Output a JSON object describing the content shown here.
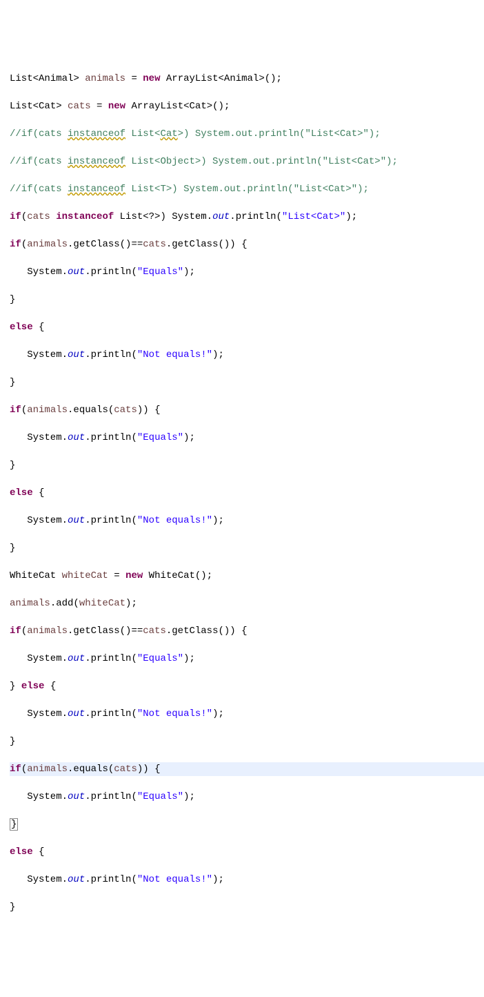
{
  "code": {
    "l1": {
      "p1": "List",
      "p2": "<",
      "p3": "Animal",
      "p4": "> ",
      "p5": "animals",
      "p6": " = ",
      "p7": "new",
      "p8": " ArrayList<",
      "p9": "Animal",
      "p10": ">();"
    },
    "l2": {
      "p1": "List",
      "p2": "<",
      "p3": "Cat",
      "p4": "> ",
      "p5": "cats",
      "p6": " = ",
      "p7": "new",
      "p8": " ArrayList<",
      "p9": "Cat",
      "p10": ">();"
    },
    "l3": {
      "p1": "//if(cats ",
      "p2": "instanceof",
      "p3": " List<",
      "p4": "Cat",
      "p5": ">) System.out.println(\"List<Cat>\");"
    },
    "l4": {
      "p1": "//if(cats ",
      "p2": "instanceof",
      "p3": " List<Object>) System.out.println(\"List<Cat>\");"
    },
    "l5": {
      "p1": "//if(cats ",
      "p2": "instanceof",
      "p3": " List<",
      "p4": "T",
      "p5": ">) System.out.println(\"List<Cat>\");"
    },
    "l6": {
      "p1": "if",
      "p2": "(",
      "p3": "cats",
      "p4": " ",
      "p5": "instanceof",
      "p6": " List<?>) System.",
      "p7": "out",
      "p8": ".println(",
      "p9": "\"List<Cat>\"",
      "p10": ");"
    },
    "l7": {
      "p1": "if",
      "p2": "(",
      "p3": "animals",
      "p4": ".getClass()==",
      "p5": "cats",
      "p6": ".getClass()) {"
    },
    "l8": {
      "p1": "   System.",
      "p2": "out",
      "p3": ".println(",
      "p4": "\"Equals\"",
      "p5": ");"
    },
    "l9": {
      "p1": "}"
    },
    "l10": {
      "p1": "else",
      "p2": " {"
    },
    "l11": {
      "p1": "   System.",
      "p2": "out",
      "p3": ".println(",
      "p4": "\"Not equals!\"",
      "p5": ");"
    },
    "l12": {
      "p1": "}"
    },
    "l13": {
      "p1": "if",
      "p2": "(",
      "p3": "animals",
      "p4": ".equals(",
      "p5": "cats",
      "p6": ")) {"
    },
    "l14": {
      "p1": "   System.",
      "p2": "out",
      "p3": ".println(",
      "p4": "\"Equals\"",
      "p5": ");"
    },
    "l15": {
      "p1": "}"
    },
    "l16": {
      "p1": "else",
      "p2": " {"
    },
    "l17": {
      "p1": "   System.",
      "p2": "out",
      "p3": ".println(",
      "p4": "\"Not equals!\"",
      "p5": ");"
    },
    "l18": {
      "p1": "}"
    },
    "l19": {
      "p1": "WhiteCat",
      "p2": " ",
      "p3": "whiteCat",
      "p4": " = ",
      "p5": "new",
      "p6": " WhiteCat();"
    },
    "l20": {
      "p1": "animals",
      "p2": ".add(",
      "p3": "whiteCat",
      "p4": ");"
    },
    "l21": {
      "p1": "if",
      "p2": "(",
      "p3": "animals",
      "p4": ".getClass()==",
      "p5": "cats",
      "p6": ".getClass()) {"
    },
    "l22": {
      "p1": "   System.",
      "p2": "out",
      "p3": ".println(",
      "p4": "\"Equals\"",
      "p5": ");"
    },
    "l23": {
      "p1": "} ",
      "p2": "else",
      "p3": " {"
    },
    "l24": {
      "p1": "   System.",
      "p2": "out",
      "p3": ".println(",
      "p4": "\"Not equals!\"",
      "p5": ");"
    },
    "l25": {
      "p1": "}"
    },
    "l26": {
      "p1": "if",
      "p2": "(",
      "p3": "animals",
      "p4": ".equals(",
      "p5": "cats",
      "p6": ")) {"
    },
    "l27": {
      "p1": "   System.",
      "p2": "out",
      "p3": ".println(",
      "p4": "\"Equals\"",
      "p5": ");"
    },
    "l28": {
      "p1": "}"
    },
    "l29": {
      "p1": "else",
      "p2": " {"
    },
    "l30": {
      "p1": "   System.",
      "p2": "out",
      "p3": ".println(",
      "p4": "\"Not equals!\"",
      "p5": ");"
    },
    "l31": {
      "p1": "}"
    }
  }
}
